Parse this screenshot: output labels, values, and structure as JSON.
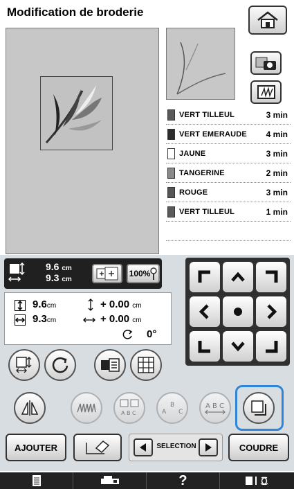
{
  "header": {
    "title": "Modification de broderie"
  },
  "size": {
    "width_value": "9.6",
    "width_unit": "cm",
    "height_value": "9.3",
    "height_unit": "cm",
    "zoom_label": "100%"
  },
  "thread_list": [
    {
      "name": "VERT TILLEUL",
      "time": "3 min",
      "color": "#5a5a5a"
    },
    {
      "name": "VERT EMERAUDE",
      "time": "4 min",
      "color": "#2c2c2c"
    },
    {
      "name": "JAUNE",
      "time": "3 min",
      "color": "#ffffff"
    },
    {
      "name": "TANGERINE",
      "time": "2 min",
      "color": "#8a8a8a"
    },
    {
      "name": "ROUGE",
      "time": "3 min",
      "color": "#555555"
    },
    {
      "name": "VERT TILLEUL",
      "time": "1 min",
      "color": "#5a5a5a"
    }
  ],
  "info": {
    "height_value": "9.6",
    "height_unit": "cm",
    "width_value": "9.3",
    "width_unit": "cm",
    "offset_v": "+ 0.00",
    "offset_v_unit": "cm",
    "offset_h": "+ 0.00",
    "offset_h_unit": "cm",
    "rotation": "0°"
  },
  "bottom": {
    "add_label": "AJOUTER",
    "selection_label": "SELECTION",
    "sew_label": "COUDRE"
  },
  "statusbar": {
    "help_label": "?"
  },
  "icons": [
    "home-icon",
    "camera-icon",
    "thread-icon",
    "size-icon",
    "zoom-icon",
    "resize-icon",
    "rotate-icon",
    "array-icon",
    "density-icon",
    "mirror-icon",
    "stitch-icon",
    "text-icon",
    "arc-icon",
    "spacing-icon",
    "outline-icon",
    "eraser-icon",
    "doc-icon",
    "machine-icon",
    "needle-icon"
  ]
}
